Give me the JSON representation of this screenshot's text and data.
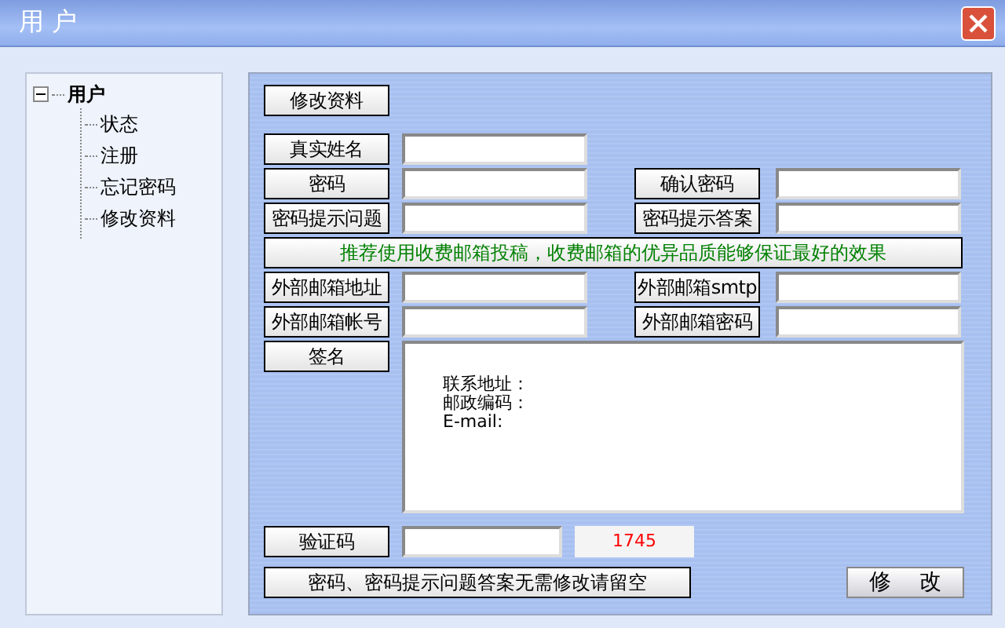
{
  "window": {
    "title": "用 户"
  },
  "tree": {
    "label": "用户",
    "expanded": true,
    "children": [
      {
        "label": "状态"
      },
      {
        "label": "注册"
      },
      {
        "label": "忘记密码"
      },
      {
        "label": "修改资料"
      }
    ]
  },
  "form": {
    "header_button": "修改资料",
    "rows": [
      {
        "kind": "pair",
        "left": "真实姓名"
      },
      {
        "kind": "pair",
        "left": "密码",
        "right": "确认密码"
      },
      {
        "kind": "pair",
        "left": "密码提示问题",
        "right": "密码提示答案"
      },
      {
        "kind": "banner",
        "text": "推荐使用收费邮箱投稿，收费邮箱的优异品质能够保证最好的效果"
      },
      {
        "kind": "pair",
        "left": "外部邮箱地址",
        "right": "外部邮箱smtp"
      },
      {
        "kind": "pair",
        "left": "外部邮箱帐号",
        "right": "外部邮箱密码"
      },
      {
        "kind": "textarea",
        "left": "签名",
        "lines": [
          "联系地址：",
          "邮政编码：",
          "E-mail:"
        ]
      },
      {
        "kind": "captcha",
        "left": "验证码",
        "code": "1745"
      },
      {
        "kind": "actions",
        "note": "密码、密码提示问题答案无需修改请留空",
        "submit": "修    改"
      }
    ]
  }
}
